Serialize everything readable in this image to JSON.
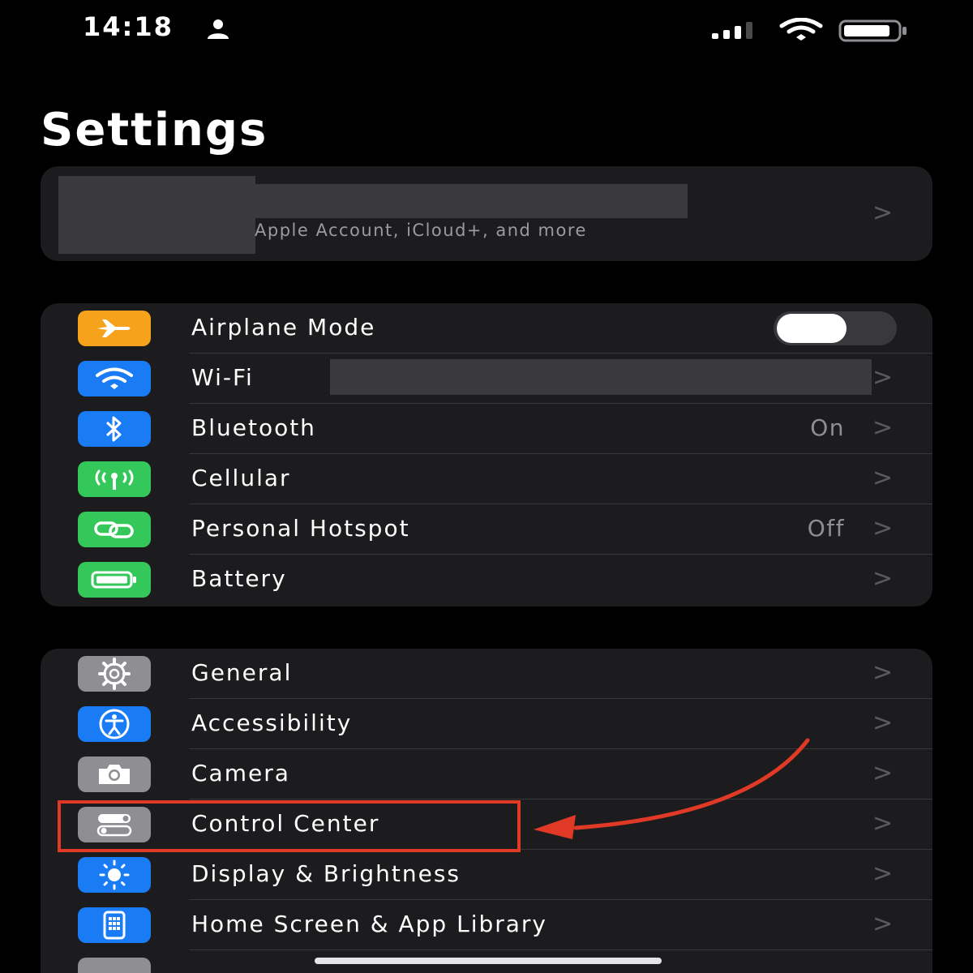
{
  "status_bar": {
    "time": "14:18"
  },
  "page": {
    "title": "Settings"
  },
  "account": {
    "subtitle": "Apple Account, iCloud+, and more"
  },
  "group_connectivity": [
    {
      "label": "Airplane Mode",
      "icon": "airplane-icon",
      "color": "#f7a21b",
      "toggle_on": false
    },
    {
      "label": "Wi-Fi",
      "icon": "wifi-icon",
      "color": "#1a7cf5",
      "value": ""
    },
    {
      "label": "Bluetooth",
      "icon": "bluetooth-icon",
      "color": "#1a7cf5",
      "value": "On"
    },
    {
      "label": "Cellular",
      "icon": "cellular-antenna-icon",
      "color": "#34c759",
      "value": ""
    },
    {
      "label": "Personal Hotspot",
      "icon": "hotspot-link-icon",
      "color": "#34c759",
      "value": "Off"
    },
    {
      "label": "Battery",
      "icon": "battery-icon",
      "color": "#34c759",
      "value": ""
    }
  ],
  "group_general": [
    {
      "label": "General",
      "icon": "gear-icon",
      "color": "#8e8e93"
    },
    {
      "label": "Accessibility",
      "icon": "accessibility-icon",
      "color": "#1a7cf5"
    },
    {
      "label": "Camera",
      "icon": "camera-icon",
      "color": "#8e8e93"
    },
    {
      "label": "Control Center",
      "icon": "control-center-icon",
      "color": "#8e8e93",
      "highlighted": true
    },
    {
      "label": "Display & Brightness",
      "icon": "sun-icon",
      "color": "#1a7cf5"
    },
    {
      "label": "Home Screen & App Library",
      "icon": "home-screen-icon",
      "color": "#1a7cf5"
    }
  ],
  "annotation_color": "#e03a26",
  "chevron": ">"
}
